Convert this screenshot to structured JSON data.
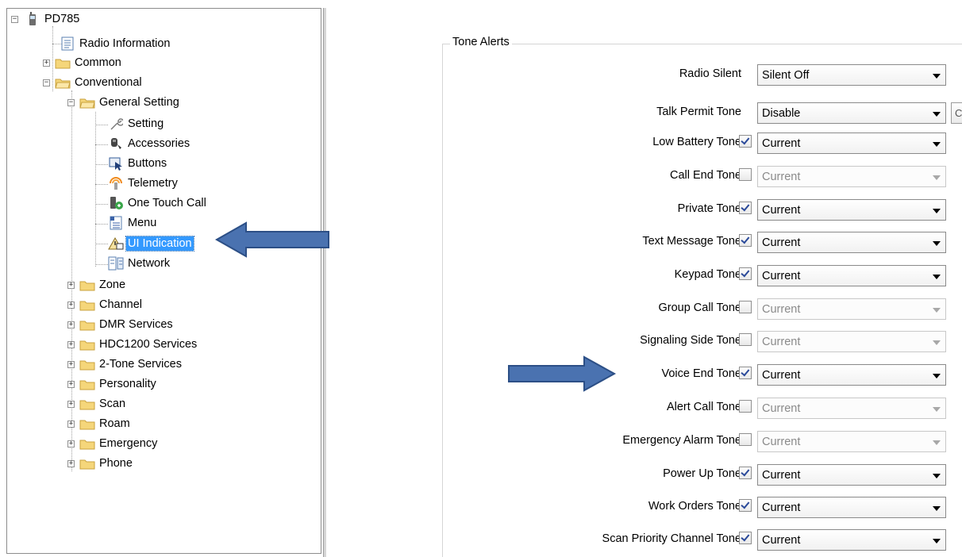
{
  "tree": {
    "root": "PD785",
    "radio_information": "Radio Information",
    "common": "Common",
    "conventional": "Conventional",
    "general_setting": "General Setting",
    "setting": "Setting",
    "accessories": "Accessories",
    "buttons": "Buttons",
    "telemetry": "Telemetry",
    "one_touch_call": "One Touch Call",
    "menu": "Menu",
    "ui_indication": "UI Indication",
    "network": "Network",
    "zone": "Zone",
    "channel": "Channel",
    "dmr_services": "DMR Services",
    "hdc1200_services": "HDC1200 Services",
    "two_tone_services": "2-Tone Services",
    "personality": "Personality",
    "scan": "Scan",
    "roam": "Roam",
    "emergency": "Emergency",
    "phone": "Phone"
  },
  "tone_alerts": {
    "group_title": "Tone Alerts",
    "radio_silent": {
      "label": "Radio Silent",
      "value": "Silent Off"
    },
    "talk_permit_tone": {
      "label": "Talk Permit Tone",
      "value": "Disable",
      "side_button": "C"
    },
    "low_battery_tone": {
      "label": "Low Battery Tone",
      "value": "Current",
      "checked": true
    },
    "call_end_tone": {
      "label": "Call End Tone",
      "value": "Current",
      "checked": false
    },
    "private_tone": {
      "label": "Private Tone",
      "value": "Current",
      "checked": true
    },
    "text_message_tone": {
      "label": "Text Message Tone",
      "value": "Current",
      "checked": true
    },
    "keypad_tone": {
      "label": "Keypad Tone",
      "value": "Current",
      "checked": true
    },
    "group_call_tone": {
      "label": "Group Call Tone",
      "value": "Current",
      "checked": false
    },
    "signaling_side_tone": {
      "label": "Signaling Side Tone",
      "value": "Current",
      "checked": false
    },
    "voice_end_tone": {
      "label": "Voice End Tone",
      "value": "Current",
      "checked": true
    },
    "alert_call_tone": {
      "label": "Alert Call Tone",
      "value": "Current",
      "checked": false
    },
    "emergency_alarm_tone": {
      "label": "Emergency Alarm Tone",
      "value": "Current",
      "checked": false
    },
    "power_up_tone": {
      "label": "Power Up Tone",
      "value": "Current",
      "checked": true
    },
    "work_orders_tone": {
      "label": "Work Orders Tone",
      "value": "Current",
      "checked": true
    },
    "scan_priority_channel_tone": {
      "label": "Scan Priority Channel Tone",
      "value": "Current",
      "checked": true
    }
  },
  "colors": {
    "selection": "#3399ff",
    "arrow_fill": "#4a72b0",
    "arrow_stroke": "#2c4f86",
    "folder": "#f5d67a"
  }
}
